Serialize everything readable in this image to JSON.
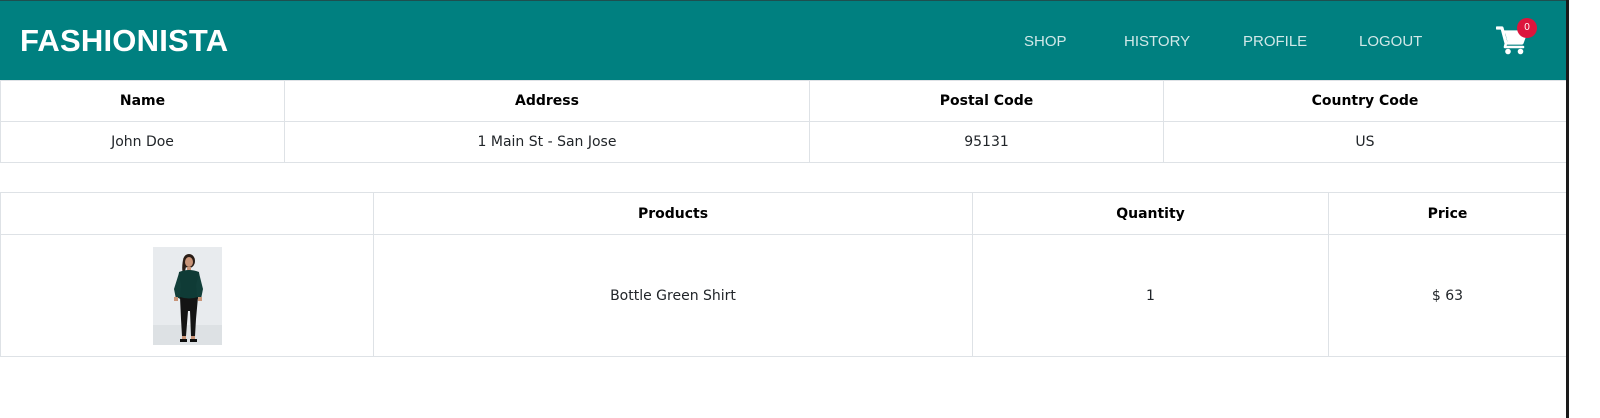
{
  "navbar": {
    "brand": "FASHIONISTA",
    "links": [
      "SHOP",
      "HISTORY",
      "PROFILE",
      "LOGOUT"
    ],
    "cart_icon": "shopping-cart-icon",
    "cart_count": "0",
    "background_color": "#008080",
    "badge_color": "#dc143c"
  },
  "shipping": {
    "headers": [
      "Name",
      "Address",
      "Postal Code",
      "Country Code"
    ],
    "row": [
      "John Doe",
      "1 Main St - San Jose",
      "95131",
      "US"
    ]
  },
  "order": {
    "headers": [
      "",
      "Products",
      "Quantity",
      "Price"
    ],
    "items": [
      {
        "image": "product-thumbnail",
        "product": "Bottle Green Shirt",
        "quantity": "1",
        "price": "$ 63"
      }
    ]
  }
}
